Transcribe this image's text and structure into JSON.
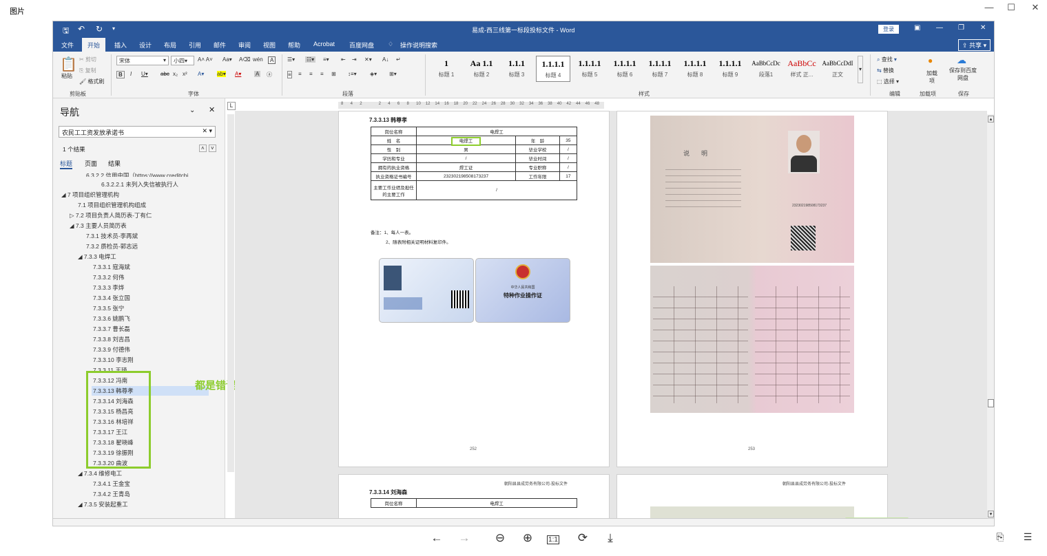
{
  "viewer": {
    "title": "图片"
  },
  "word": {
    "doc_title": "易成-西三线第一标段投标文件 - Word",
    "login": "登录",
    "share": "共享"
  },
  "menu": [
    "文件",
    "开始",
    "插入",
    "设计",
    "布局",
    "引用",
    "邮件",
    "审阅",
    "视图",
    "帮助",
    "Acrobat",
    "百度网盘"
  ],
  "tell_me": "操作说明搜索",
  "ribbon": {
    "clipboard": {
      "paste": "粘贴",
      "cut": "剪切",
      "copy": "复制",
      "format_painter": "格式刷",
      "label": "剪贴板"
    },
    "font": {
      "name": "宋体",
      "size": "小四",
      "label": "字体"
    },
    "paragraph": {
      "label": "段落"
    },
    "styles": {
      "label": "样式",
      "items": [
        {
          "sample": "1",
          "name": "标题 1"
        },
        {
          "sample": "Aa 1.1",
          "name": "标题 2"
        },
        {
          "sample": "1.1.1",
          "name": "标题 3"
        },
        {
          "sample": "1.1.1.1",
          "name": "标题 4"
        },
        {
          "sample": "1.1.1.1",
          "name": "标题 5"
        },
        {
          "sample": "1.1.1.1",
          "name": "标题 6"
        },
        {
          "sample": "1.1.1.1",
          "name": "标题 7"
        },
        {
          "sample": "1.1.1.1",
          "name": "标题 8"
        },
        {
          "sample": "1.1.1.1",
          "name": "标题 9"
        },
        {
          "sample": "AaBbCcDc",
          "name": "段落1"
        },
        {
          "sample": "AaBbCc",
          "name": "样式 正..."
        },
        {
          "sample": "AaBbCcDdI",
          "name": "正文"
        }
      ]
    },
    "editing": {
      "find": "查找",
      "replace": "替换",
      "select": "选择",
      "label": "编辑"
    },
    "addins": {
      "add": "加载项",
      "label": "加载项"
    },
    "save": {
      "save_to": "保存到百度网盘",
      "label": "保存"
    }
  },
  "nav": {
    "title": "导航",
    "search_value": "农民工工资发放承诺书",
    "result_count": "1 个结果",
    "tabs": [
      "标题",
      "页面",
      "结果"
    ],
    "items": [
      "6.3.2.2 信用中国（https://www.creditchi...",
      "6.3.2.2.1 未列入失信被执行人",
      "7 项目组织管理机构",
      "7.1 项目组织管理机构组成",
      "7.2 项目负责人简历表-丁有仁",
      "7.3 主要人员简历表",
      "7.3.1 技术员-李再斌",
      "7.3.2 质检员-郭志远",
      "7.3.3 电焊工",
      "7.3.3.1 寇海斌",
      "7.3.3.2 何伟",
      "7.3.3.3 李烨",
      "7.3.3.4 张立国",
      "7.3.3.5 张宁",
      "7.3.3.6 姚鹏飞",
      "7.3.3.7 曹长磊",
      "7.3.3.8 刘吉昌",
      "7.3.3.9 付德伟",
      "7.3.3.10 李志刚",
      "7.3.3.11 王琦",
      "7.3.3.12 冯南",
      "7.3.3.13 韩尊孝",
      "7.3.3.14 刘海森",
      "7.3.3.15 杨昌亮",
      "7.3.3.16 林培祥",
      "7.3.3.17 王江",
      "7.3.3.18 翟晓峰",
      "7.3.3.19 徐振刚",
      "7.3.3.20 曲波",
      "7.3.4 维修电工",
      "7.3.4.1 王金宝",
      "7.3.4.2 王青岛",
      "7.3.5 安装起重工"
    ]
  },
  "annotation": {
    "text": "都是错误的",
    "color": "#8ccc2c"
  },
  "page1": {
    "heading": "7.3.3.13 韩尊孝",
    "rows": [
      [
        "岗位名称",
        "电焊工"
      ],
      [
        "姓　名",
        "电焊工",
        "年　龄",
        "35"
      ],
      [
        "性　别",
        "男",
        "毕业学校",
        "/"
      ],
      [
        "学历和专业",
        "/",
        "毕业时间",
        "/"
      ],
      [
        "拥有的执业资格",
        "焊工证",
        "专业职称",
        "/"
      ],
      [
        "执业资格证书编号",
        "232302198508173237",
        "工作年限",
        "17"
      ],
      [
        "主要工作业绩及担任的主要工作",
        "/"
      ]
    ],
    "note1": "备注：1、每人一表。",
    "note2": "2、随表附相关证明材料复印件。",
    "card_title": "特种作业操作证",
    "card_country": "中华人民共和国",
    "page_number": "252"
  },
  "page2": {
    "explain_title": "说　明",
    "id_number": "232302198508173237",
    "page_number": "253"
  },
  "page3": {
    "header": "朝阳县县成劳务有限公司-投标文件",
    "heading": "7.3.3.14 刘海森",
    "row": [
      "岗位名称",
      "电焊工"
    ]
  },
  "page4": {
    "header": "朝阳县县成劳务有限公司-投标文件"
  },
  "ruler_numbers": [
    "8",
    "4",
    "2",
    "",
    "2",
    "4",
    "6",
    "8",
    "10",
    "12",
    "14",
    "16",
    "18",
    "20",
    "22",
    "24",
    "26",
    "28",
    "30",
    "32",
    "34",
    "36",
    "38",
    "40",
    "42",
    "44",
    "46",
    "48"
  ]
}
